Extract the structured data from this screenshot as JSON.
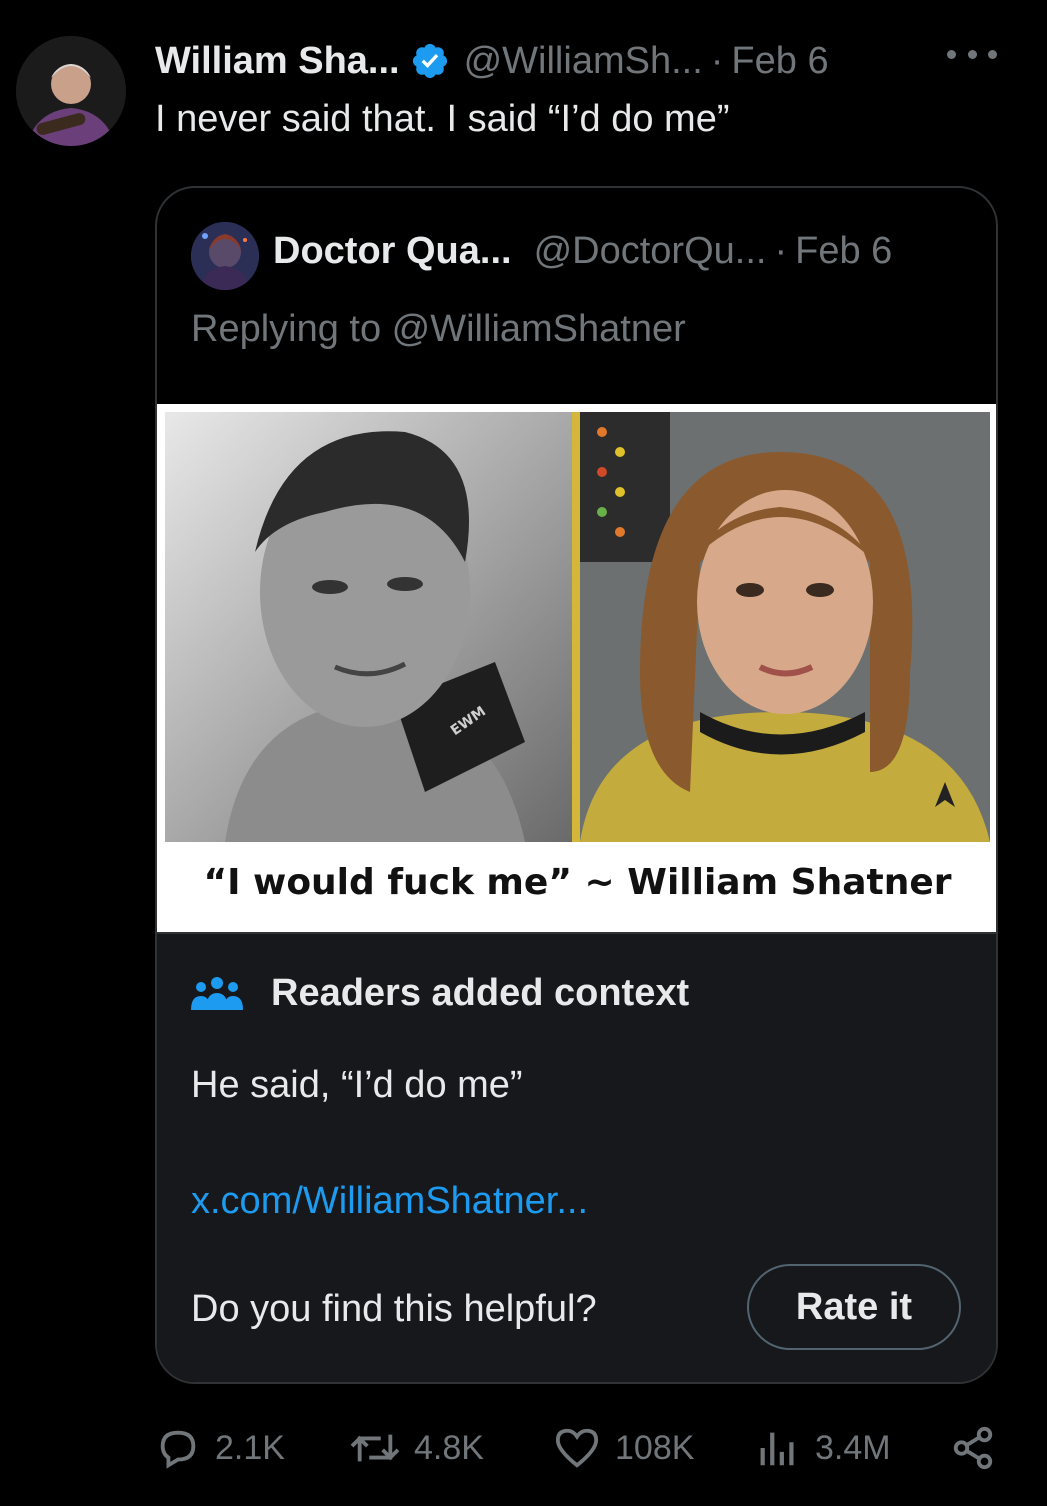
{
  "tweet": {
    "author_name": "William Sha...",
    "author_handle": "@WilliamSh...",
    "separator": "·",
    "date": "Feb 6",
    "text": "I never said that. I said “I’d do me”"
  },
  "quoted": {
    "author_name": "Doctor Qua...",
    "author_handle": "@DoctorQu...",
    "separator": "·",
    "date": "Feb 6",
    "replying_to": "Replying to @WilliamShatner",
    "meme_caption": "“I would fuck me” ~ William Shatner",
    "shirt_text": "EWM"
  },
  "community_note": {
    "title": "Readers added context",
    "body": "He said, “I’d do me”",
    "link": "x.com/WilliamShatner...",
    "question": "Do you find this helpful?",
    "rate_label": "Rate it"
  },
  "actions": {
    "replies": "2.1K",
    "reposts": "4.8K",
    "likes": "108K",
    "views": "3.4M"
  },
  "colors": {
    "background": "#000000",
    "text": "#e7e9ea",
    "muted": "#71767b",
    "link": "#1d9bf0",
    "verified": "#1d9bf0"
  }
}
